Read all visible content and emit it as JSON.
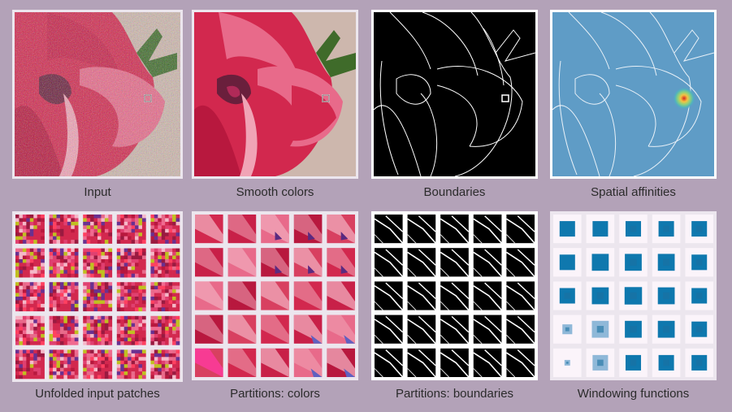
{
  "panels": [
    {
      "id": "input",
      "caption": "Input"
    },
    {
      "id": "smooth",
      "caption": "Smooth colors"
    },
    {
      "id": "boundaries",
      "caption": "Boundaries"
    },
    {
      "id": "affinities",
      "caption": "Spatial affinities"
    },
    {
      "id": "unfolded",
      "caption": "Unfolded input patches"
    },
    {
      "id": "part-colors",
      "caption": "Partitions: colors"
    },
    {
      "id": "part-bounds",
      "caption": "Partitions: boundaries"
    },
    {
      "id": "windowing",
      "caption": "Windowing functions"
    }
  ],
  "colors": {
    "background": "#b3a2b8",
    "petal_red": "#d2284e",
    "petal_pink": "#e86a8a",
    "petal_light": "#f0a4b6",
    "dark_center": "#6a1f3c",
    "leaf_green": "#3f6b2a",
    "affinity_blue": "#5f9cc6",
    "window_blue": "#0f78ae"
  }
}
